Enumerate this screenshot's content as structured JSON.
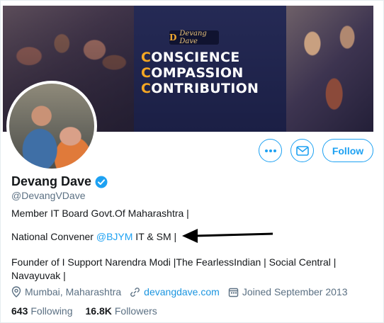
{
  "banner": {
    "logo_text": "Devang Dave",
    "tagline": [
      {
        "first": "C",
        "rest": "ONSCIENCE"
      },
      {
        "first": "C",
        "rest": "OMPASSION"
      },
      {
        "first": "C",
        "rest": "ONTRIBUTION"
      }
    ]
  },
  "profile": {
    "display_name": "Devang Dave",
    "verified_icon": "verified-badge-icon",
    "handle": "@DevangVDave",
    "bio_line1": "Member IT Board Govt.Of Maharashtra |",
    "bio_line2_prefix": "National Convener ",
    "bio_line2_mention": "@BJYM",
    "bio_line2_suffix": " IT & SM |",
    "bio_line3": "Founder of  I Support Narendra Modi |The FearlessIndian | Social Central | Navayuvak |"
  },
  "meta": {
    "location": "Mumbai, Maharashtra",
    "website": "devangdave.com",
    "joined": "Joined September 2013"
  },
  "stats": {
    "following_count": "643",
    "following_label": "Following",
    "followers_count": "16.8K",
    "followers_label": "Followers"
  },
  "actions": {
    "follow_label": "Follow"
  },
  "colors": {
    "accent": "#1da1f2",
    "tagline_accent": "#f4a724",
    "banner_bg": "#1c2347"
  }
}
